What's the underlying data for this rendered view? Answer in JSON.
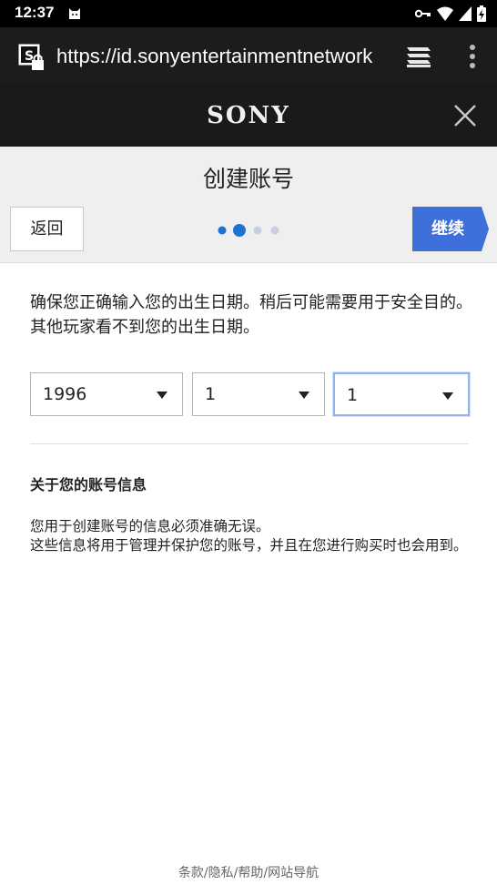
{
  "status_bar": {
    "time": "12:37"
  },
  "browser": {
    "url": "https://id.sonyentertainmentnetwork"
  },
  "header": {
    "brand": "SONY"
  },
  "page": {
    "title": "创建账号",
    "back_label": "返回",
    "continue_label": "继续",
    "step_current": 2,
    "step_total": 4
  },
  "content": {
    "intro": "确保您正确输入您的出生日期。稍后可能需要用于安全目的。其他玩家看不到您的出生日期。",
    "birth_year": "1996",
    "birth_month": "1",
    "birth_day": "1",
    "section_title": "关于您的账号信息",
    "info_line1": "您用于创建账号的信息必须准确无误。",
    "info_line2": "这些信息将用于管理并保护您的账号，并且在您进行购买时也会用到。"
  },
  "footer": {
    "links": "条款/隐私/帮助/网站导航"
  },
  "colors": {
    "accent": "#3f6fd8",
    "dot_active": "#1e73d1",
    "dot_inactive": "#c5d0dc"
  }
}
